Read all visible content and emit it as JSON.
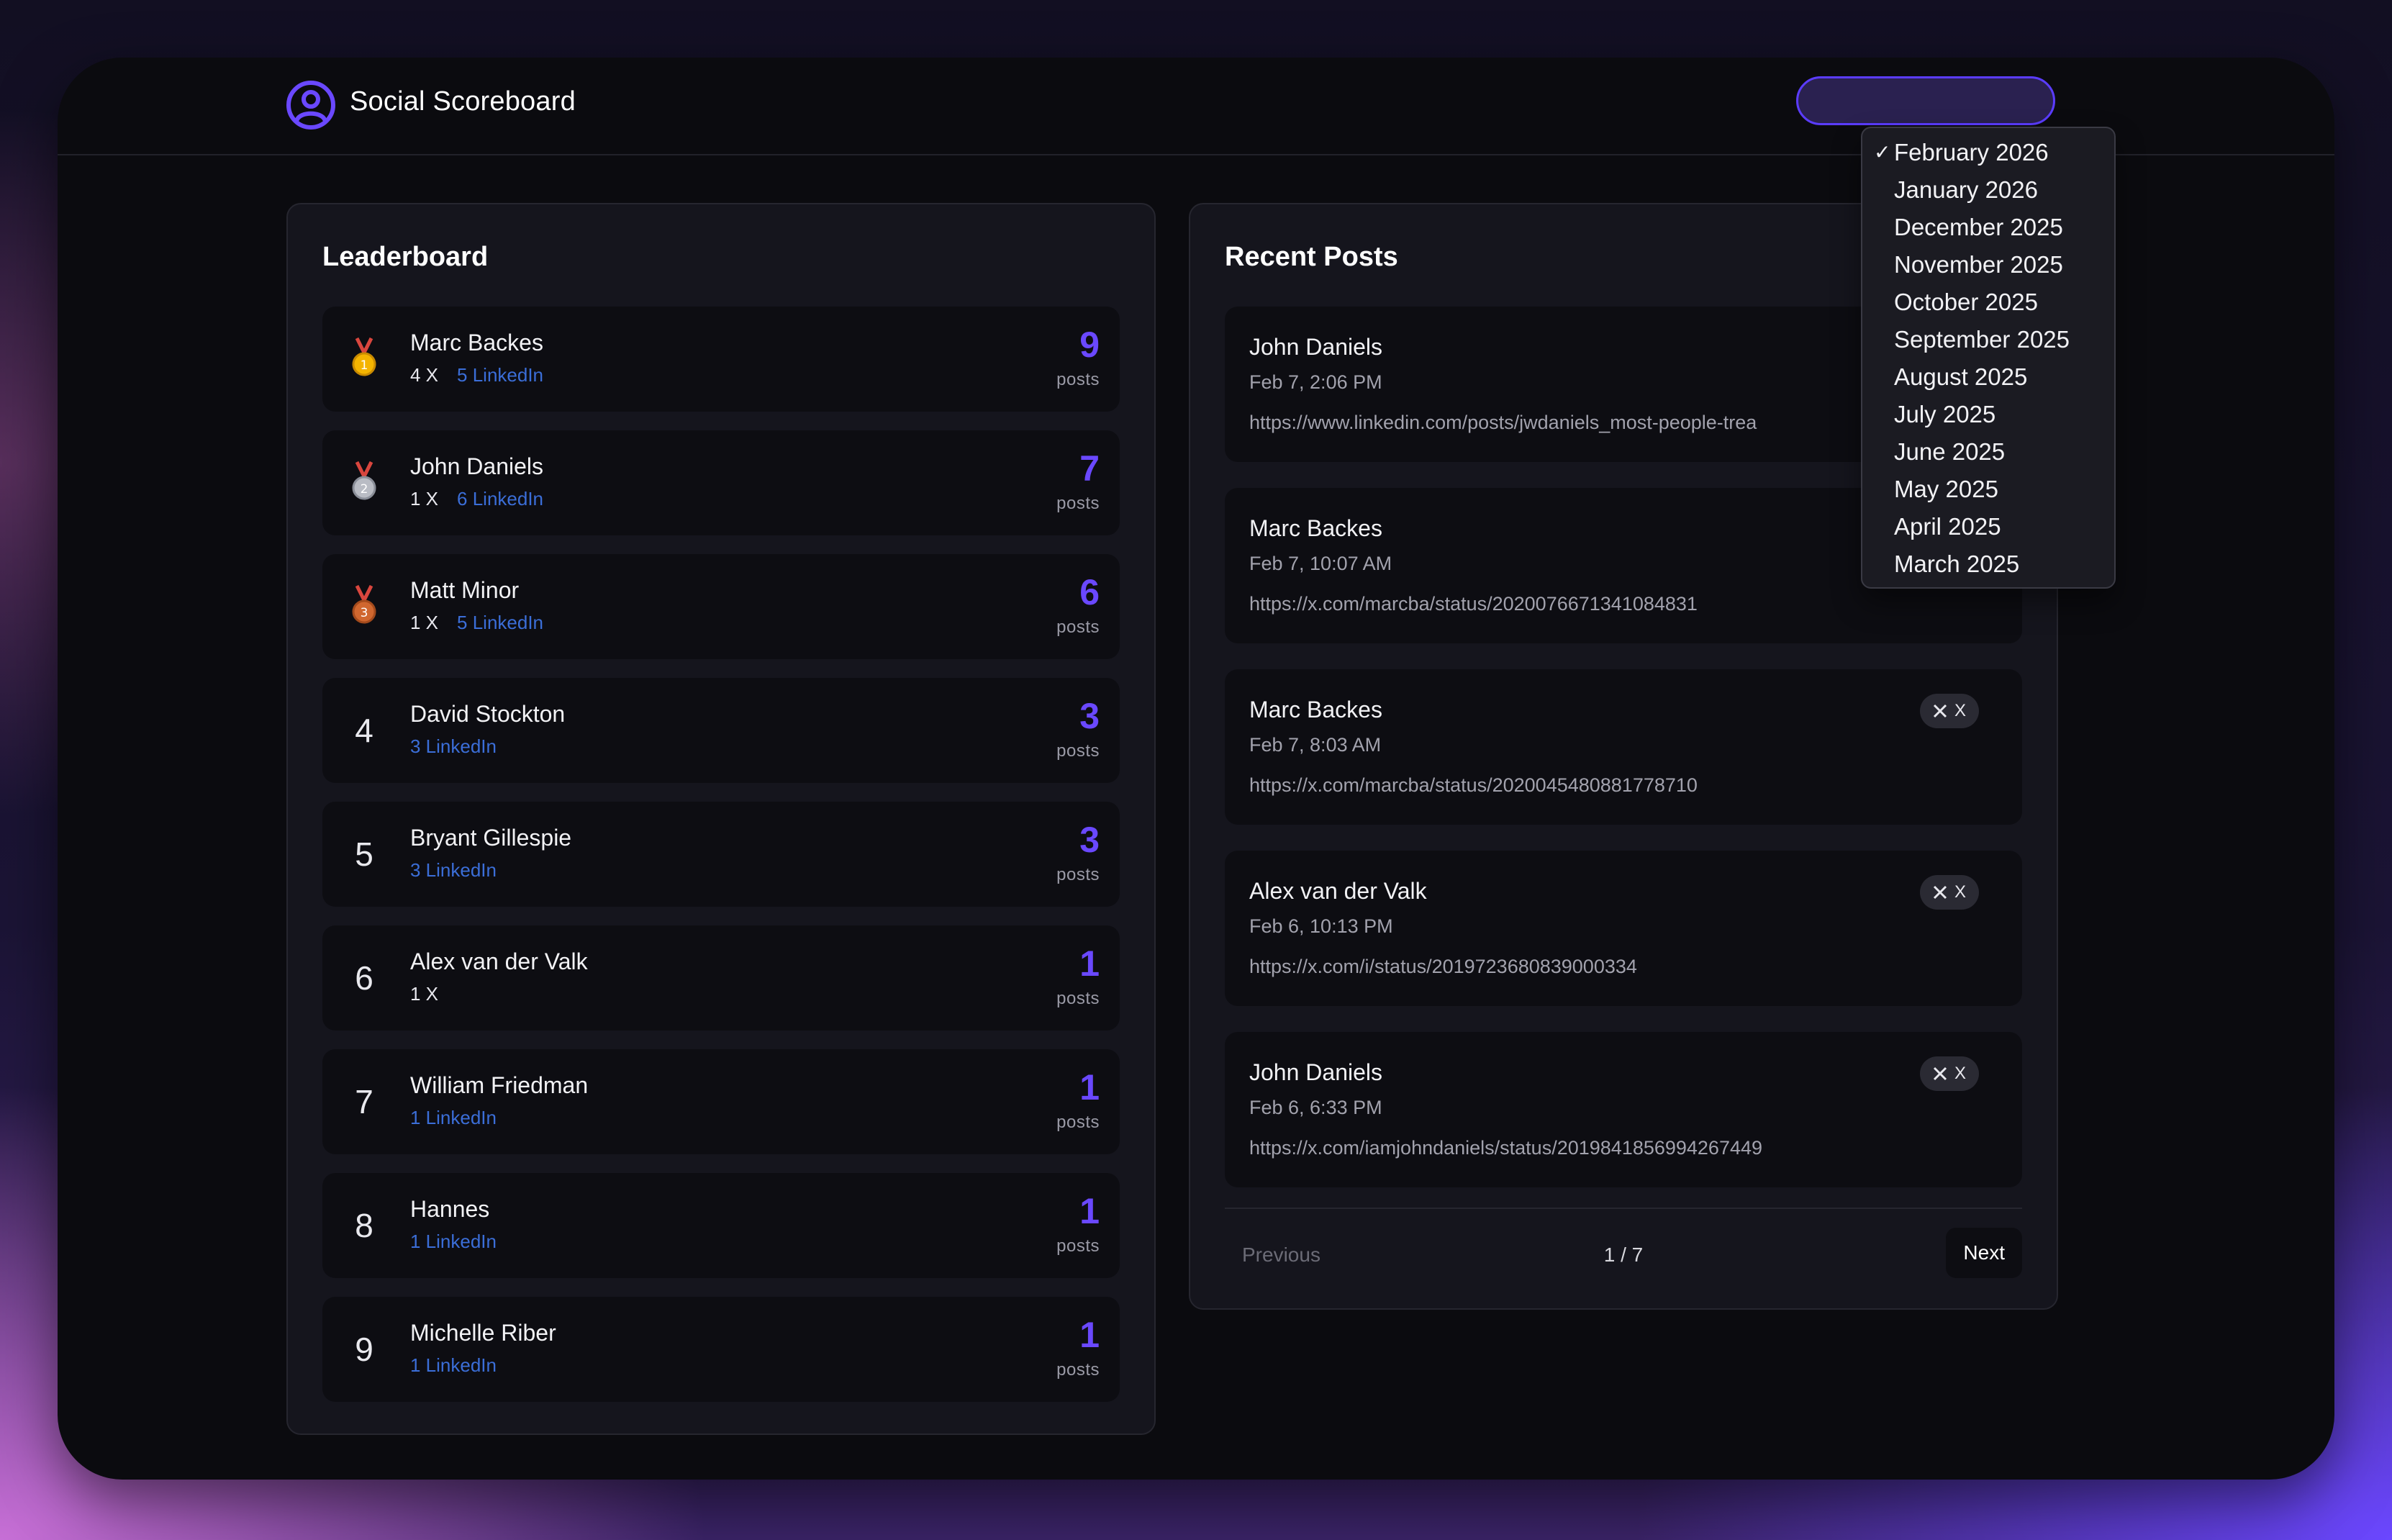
{
  "header": {
    "title": "Social Scoreboard",
    "logo_icon": "user-circle-icon",
    "accent_color": "#6a48ff"
  },
  "leaderboard": {
    "title": "Leaderboard",
    "count_label": "posts",
    "rows": [
      {
        "rank": "",
        "medal": "gold",
        "name": "Marc Backes",
        "x": "4 X",
        "linkedin": "5 LinkedIn",
        "count": "9"
      },
      {
        "rank": "",
        "medal": "silver",
        "name": "John Daniels",
        "x": "1 X",
        "linkedin": "6 LinkedIn",
        "count": "7"
      },
      {
        "rank": "",
        "medal": "bronze",
        "name": "Matt Minor",
        "x": "1 X",
        "linkedin": "5 LinkedIn",
        "count": "6"
      },
      {
        "rank": "4",
        "medal": "",
        "name": "David Stockton",
        "x": "",
        "linkedin": "3 LinkedIn",
        "count": "3"
      },
      {
        "rank": "5",
        "medal": "",
        "name": "Bryant Gillespie",
        "x": "",
        "linkedin": "3 LinkedIn",
        "count": "3"
      },
      {
        "rank": "6",
        "medal": "",
        "name": "Alex van der Valk",
        "x": "1 X",
        "linkedin": "",
        "count": "1"
      },
      {
        "rank": "7",
        "medal": "",
        "name": "William Friedman",
        "x": "",
        "linkedin": "1 LinkedIn",
        "count": "1"
      },
      {
        "rank": "8",
        "medal": "",
        "name": "Hannes",
        "x": "",
        "linkedin": "1 LinkedIn",
        "count": "1"
      },
      {
        "rank": "9",
        "medal": "",
        "name": "Michelle Riber",
        "x": "",
        "linkedin": "1 LinkedIn",
        "count": "1"
      }
    ]
  },
  "recent_posts": {
    "title": "Recent Posts",
    "posts": [
      {
        "author": "John Daniels",
        "time": "Feb 7, 2:06 PM",
        "url": "https://www.linkedin.com/posts/jwdaniels_most-people-trea",
        "badge": ""
      },
      {
        "author": "Marc Backes",
        "time": "Feb 7, 10:07 AM",
        "url": "https://x.com/marcba/status/2020076671341084831",
        "badge": ""
      },
      {
        "author": "Marc Backes",
        "time": "Feb 7, 8:03 AM",
        "url": "https://x.com/marcba/status/2020045480881778710",
        "badge": "X"
      },
      {
        "author": "Alex van der Valk",
        "time": "Feb 6, 10:13 PM",
        "url": "https://x.com/i/status/2019723680839000334",
        "badge": "X"
      },
      {
        "author": "John Daniels",
        "time": "Feb 6, 6:33 PM",
        "url": "https://x.com/iamjohndaniels/status/2019841856994267449",
        "badge": "X"
      }
    ],
    "pagination": {
      "previous": "Previous",
      "indicator": "1 / 7",
      "next": "Next"
    }
  },
  "month_select": {
    "selected": "February 2026",
    "options": [
      "February 2026",
      "January 2026",
      "December 2025",
      "November 2025",
      "October 2025",
      "September 2025",
      "August 2025",
      "July 2025",
      "June 2025",
      "May 2025",
      "April 2025",
      "March 2025"
    ]
  }
}
